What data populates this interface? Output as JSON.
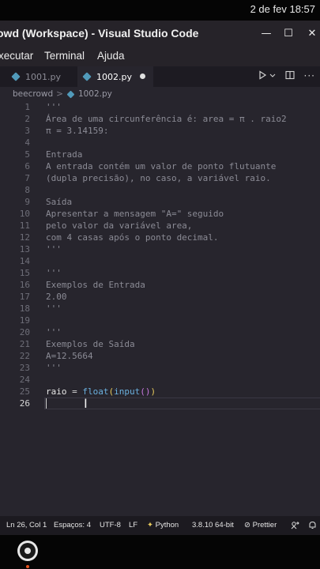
{
  "system": {
    "clock": "2 de fev  18:57"
  },
  "window": {
    "title": "owd (Workspace) - Visual Studio Code",
    "min": "—",
    "max": "☐",
    "close": "✕"
  },
  "menu": {
    "items": [
      "xecutar",
      "Terminal",
      "Ajuda"
    ]
  },
  "tabs": [
    {
      "label": "1001.py",
      "active": false
    },
    {
      "label": "1002.py",
      "active": true,
      "dirty": true
    }
  ],
  "breadcrumb": {
    "folder": "beecrowd",
    "sep": ">",
    "file": "1002.py"
  },
  "editor": {
    "lines": [
      {
        "n": "1",
        "text": "'''"
      },
      {
        "n": "2",
        "text": "Área de uma circunferência é: area = π . raio2"
      },
      {
        "n": "3",
        "text": "π = 3.14159:"
      },
      {
        "n": "4",
        "text": ""
      },
      {
        "n": "5",
        "text": "Entrada"
      },
      {
        "n": "6",
        "text": "A entrada contém um valor de ponto flutuante"
      },
      {
        "n": "7",
        "text": "(dupla precisão), no caso, a variável raio."
      },
      {
        "n": "8",
        "text": ""
      },
      {
        "n": "9",
        "text": "Saída"
      },
      {
        "n": "10",
        "text": "Apresentar a mensagem \"A=\" seguido"
      },
      {
        "n": "11",
        "text": "pelo valor da variável area,"
      },
      {
        "n": "12",
        "text": "com 4 casas após o ponto decimal."
      },
      {
        "n": "13",
        "text": "'''"
      },
      {
        "n": "14",
        "text": ""
      },
      {
        "n": "15",
        "text": "'''"
      },
      {
        "n": "16",
        "text": "Exemplos de Entrada"
      },
      {
        "n": "17",
        "text": "2.00"
      },
      {
        "n": "18",
        "text": "'''"
      },
      {
        "n": "19",
        "text": ""
      },
      {
        "n": "20",
        "text": "'''"
      },
      {
        "n": "21",
        "text": "Exemplos de Saída"
      },
      {
        "n": "22",
        "text": "A=12.5664"
      },
      {
        "n": "23",
        "text": "'''"
      },
      {
        "n": "24",
        "text": ""
      }
    ],
    "code_line": {
      "n": "25",
      "var": "raio",
      "op": " = ",
      "func1": "float",
      "p1_open": "(",
      "func2": "input",
      "p2": "()",
      "p1_close": ")"
    },
    "cursor_line": {
      "n": "26"
    }
  },
  "status": {
    "position": "Ln 26, Col 1",
    "spaces": "Espaços: 4",
    "encoding": "UTF-8",
    "eol": "LF",
    "language": "Python",
    "interpreter": "3.8.10 64-bit",
    "prettier": "Prettier"
  },
  "colors": {
    "editor_bg": "#27252d",
    "comment": "#8b8b95",
    "function": "#6bb1e0",
    "bracket": "#e6c95c",
    "bracket_nested": "#c678dd",
    "python_icon": "#519aba"
  }
}
